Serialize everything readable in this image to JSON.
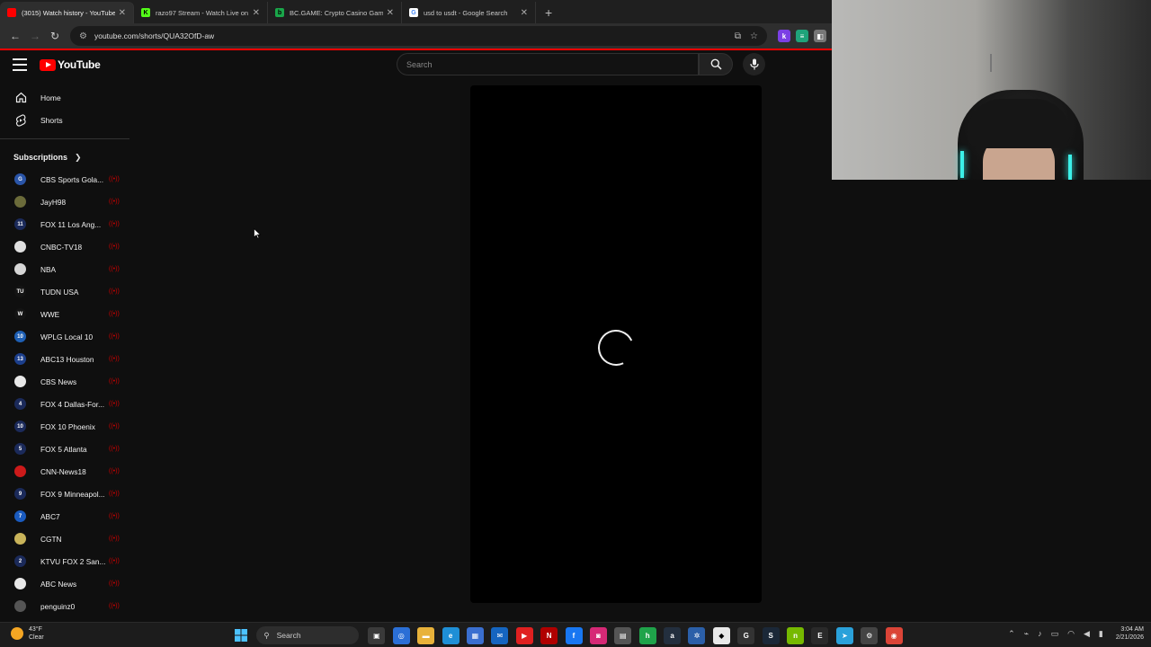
{
  "browser": {
    "tabs": [
      {
        "title": "(3015) Watch history - YouTube",
        "favicon_color": "#ff0000",
        "favicon_glyph": "",
        "active": true
      },
      {
        "title": "razo97 Stream - Watch Live on",
        "favicon_color": "#53fc18",
        "favicon_glyph": "K",
        "active": false
      },
      {
        "title": "BC.GAME: Crypto Casino Game",
        "favicon_color": "#1aa64a",
        "favicon_glyph": "b",
        "active": false
      },
      {
        "title": "usd to usdt - Google Search",
        "favicon_color": "#ffffff",
        "favicon_glyph": "G",
        "active": false
      }
    ],
    "url": "youtube.com/shorts/QUA32OfD-aw"
  },
  "youtube": {
    "logo_text": "YouTube",
    "search_placeholder": "Search",
    "nav": [
      {
        "label": "Home",
        "icon": "home-icon"
      },
      {
        "label": "Shorts",
        "icon": "shorts-icon"
      }
    ],
    "subscriptions_label": "Subscriptions",
    "subscriptions": [
      {
        "name": "CBS Sports Gola...",
        "color": "#2a55a8",
        "glyph": "G"
      },
      {
        "name": "JayH98",
        "color": "#6b6b3a",
        "glyph": ""
      },
      {
        "name": "FOX 11 Los Ang...",
        "color": "#1b2a5a",
        "glyph": "11"
      },
      {
        "name": "CNBC-TV18",
        "color": "#e0e0e0",
        "glyph": ""
      },
      {
        "name": "NBA",
        "color": "#d6d6d6",
        "glyph": ""
      },
      {
        "name": "TUDN USA",
        "color": "#141414",
        "glyph": "TU"
      },
      {
        "name": "WWE",
        "color": "#141414",
        "glyph": "W"
      },
      {
        "name": "WPLG Local 10",
        "color": "#1e5fb4",
        "glyph": "10"
      },
      {
        "name": "ABC13 Houston",
        "color": "#1c3f8c",
        "glyph": "13"
      },
      {
        "name": "CBS News",
        "color": "#e8e8e8",
        "glyph": ""
      },
      {
        "name": "FOX 4 Dallas-For...",
        "color": "#1b2a5a",
        "glyph": "4"
      },
      {
        "name": "FOX 10 Phoenix",
        "color": "#1b2a5a",
        "glyph": "10"
      },
      {
        "name": "FOX 5 Atlanta",
        "color": "#1b2a5a",
        "glyph": "5"
      },
      {
        "name": "CNN-News18",
        "color": "#cc1a1a",
        "glyph": ""
      },
      {
        "name": "FOX 9 Minneapol...",
        "color": "#1b2a5a",
        "glyph": "9"
      },
      {
        "name": "ABC7",
        "color": "#1a5bbf",
        "glyph": "7"
      },
      {
        "name": "CGTN",
        "color": "#c9b45a",
        "glyph": ""
      },
      {
        "name": "KTVU FOX 2 San...",
        "color": "#1b2a5a",
        "glyph": "2"
      },
      {
        "name": "ABC News",
        "color": "#e8e8e8",
        "glyph": ""
      },
      {
        "name": "penguinz0",
        "color": "#555555",
        "glyph": ""
      }
    ]
  },
  "taskbar": {
    "weather_temp": "43°F",
    "weather_desc": "Clear",
    "search_label": "Search",
    "time": "3:04 AM",
    "date": "2/21/2026"
  }
}
